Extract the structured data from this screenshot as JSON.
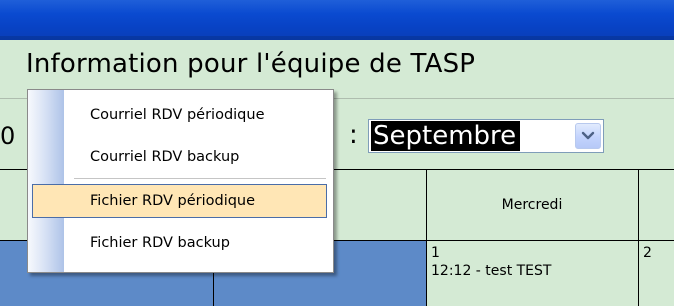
{
  "window": {
    "title": ""
  },
  "header": {
    "title": "Information pour l'équipe de TASP"
  },
  "filter": {
    "leading_fragment": "0",
    "month_label": ":",
    "month_value": "Septembre"
  },
  "context_menu": {
    "items": [
      {
        "label": "Courriel RDV périodique"
      },
      {
        "label": "Courriel RDV backup"
      },
      {
        "label": "Fichier RDV périodique",
        "highlighted": true
      },
      {
        "label": "Fichier RDV backup"
      }
    ]
  },
  "calendar": {
    "day_headers": [
      "Mercredi"
    ],
    "cells": [
      {
        "day": "1",
        "events": [
          "12:12 -  test TEST"
        ]
      },
      {
        "day": "2",
        "events": []
      }
    ]
  },
  "colors": {
    "title_bar": "#0a4ad0",
    "header_background": "#d4ead4",
    "blue_cell": "#5d8ac8",
    "menu_highlight": "#ffe6b5",
    "menu_highlight_border": "#4a6da8",
    "selected_text_background": "#000000"
  },
  "icons": {
    "dropdown": "chevron-down-icon"
  }
}
